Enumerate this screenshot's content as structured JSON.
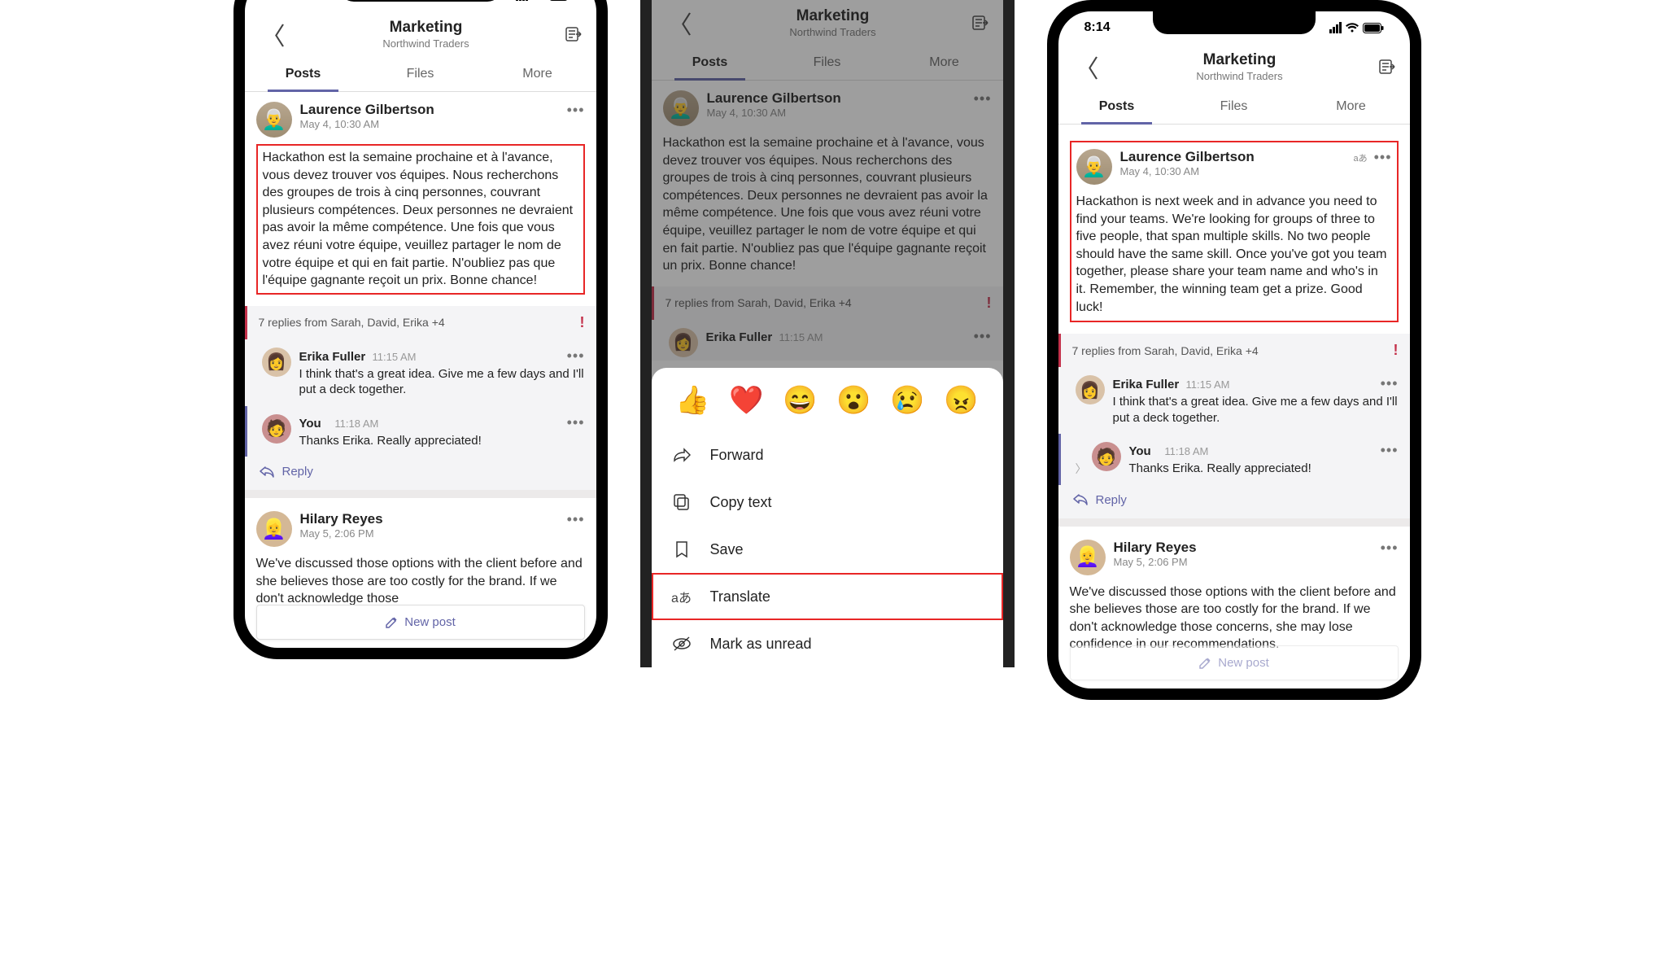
{
  "status_time": "8:14",
  "header": {
    "title": "Marketing",
    "subtitle": "Northwind Traders"
  },
  "tabs": [
    "Posts",
    "Files",
    "More"
  ],
  "posts": {
    "laurence": {
      "author": "Laurence Gilbertson",
      "time": "May 4, 10:30 AM",
      "body_fr": "Hackathon est la semaine prochaine et à l'avance, vous devez trouver vos équipes. Nous recherchons des groupes de trois à cinq personnes, couvrant plusieurs compétences. Deux personnes ne devraient pas avoir la même compétence. Une fois que vous avez réuni votre équipe, veuillez partager le nom de votre équipe et qui en fait partie. N'oubliez pas que l'équipe gagnante reçoit un prix. Bonne chance!",
      "body_en": "Hackathon is next week and in advance you need to find your teams. We're looking for groups of three to five people, that span multiple skills. No two people should have the same skill. Once you've got you team together, please share your team name and who's in it. Remember, the winning team get a prize. Good luck!"
    },
    "replies_strip": "7 replies from Sarah, David, Erika +4",
    "erika": {
      "author": "Erika Fuller",
      "time": "11:15 AM",
      "text": "I think that's a great idea. Give me a few days and I'll put a deck together."
    },
    "you": {
      "author": "You",
      "time": "11:18 AM",
      "text": "Thanks Erika. Really appreciated!"
    },
    "hilary": {
      "author": "Hilary Reyes",
      "time": "May 5, 2:06 PM",
      "text_short": "We've discussed those options with the client before and she believes those are too costly for the brand. If we don't acknowledge those",
      "text_long": "We've discussed those options with the client before and she believes those are too costly for the brand. If we don't acknowledge those concerns, she may lose confidence in our recommendations."
    }
  },
  "reply_label": "Reply",
  "new_post_label": "New post",
  "action_sheet": {
    "forward": "Forward",
    "copy": "Copy text",
    "save": "Save",
    "translate": "Translate",
    "unread": "Mark as unread"
  },
  "translate_badge": "aあ"
}
